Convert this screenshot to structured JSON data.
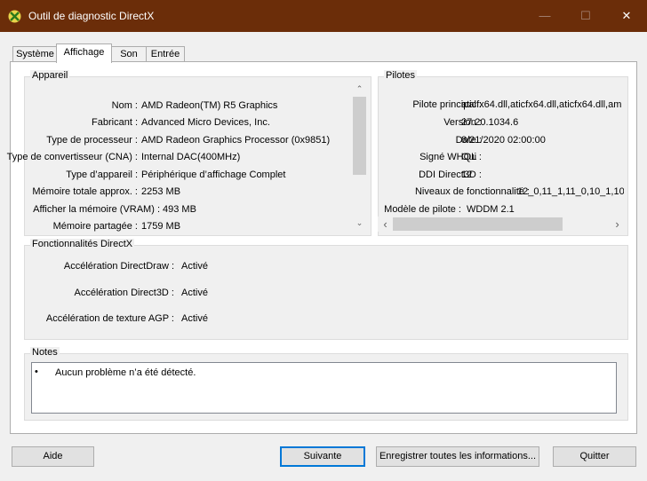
{
  "window": {
    "title": "Outil de diagnostic DirectX",
    "minimize": "—",
    "maximize": "☐",
    "close": "✕"
  },
  "tabs": [
    "Système",
    "Affichage",
    "Son",
    "Entrée"
  ],
  "device": {
    "title": "Appareil",
    "rows": [
      {
        "label": "Nom :",
        "value": "AMD Radeon(TM) R5 Graphics"
      },
      {
        "label": "Fabricant :",
        "value": "Advanced Micro Devices, Inc."
      },
      {
        "label": "Type de processeur :",
        "value": "AMD Radeon Graphics Processor (0x9851)"
      },
      {
        "label": "Type de convertisseur (CNA) :",
        "value": "Internal DAC(400MHz)"
      },
      {
        "label": "Type d’appareil :",
        "value": "Périphérique d’affichage Complet"
      },
      {
        "label": "Mémoire totale approx. :",
        "value": "2253 MB"
      },
      {
        "label": "Afficher la mémoire (VRAM) :",
        "value": "493 MB"
      },
      {
        "label": "Mémoire partagée :",
        "value": "1759 MB"
      }
    ],
    "scroll_up": "⌃",
    "scroll_down": "⌄"
  },
  "drivers": {
    "title": "Pilotes",
    "rows": [
      {
        "label": "Pilote principal :",
        "value": "aticfx64.dll,aticfx64.dll,aticfx64.dll,am"
      },
      {
        "label": "Version :",
        "value": "27.20.1034.6"
      },
      {
        "label": "Date :",
        "value": "8/21/2020 02:00:00"
      },
      {
        "label": "Signé WHQL :",
        "value": "Oui"
      },
      {
        "label": "DDI Direct3D :",
        "value": "12"
      },
      {
        "label": "Niveaux de fonctionnalité :",
        "value": "12_0,11_1,11_0,10_1,10"
      },
      {
        "label": "Modèle de pilote :",
        "value": "WDDM 2.1"
      }
    ],
    "scroll_left": "‹",
    "scroll_right": "›"
  },
  "features": {
    "title": "Fonctionnalités DirectX",
    "rows": [
      {
        "label": "Accélération DirectDraw :",
        "value": "Activé"
      },
      {
        "label": "Accélération Direct3D :",
        "value": "Activé"
      },
      {
        "label": "Accélération de texture AGP :",
        "value": "Activé"
      }
    ]
  },
  "notes": {
    "title": "Notes",
    "bullet": "•",
    "text": "Aucun problème n’a été détecté."
  },
  "buttons": {
    "help": "Aide",
    "next": "Suivante",
    "save": "Enregistrer toutes les informations...",
    "quit": "Quitter"
  }
}
